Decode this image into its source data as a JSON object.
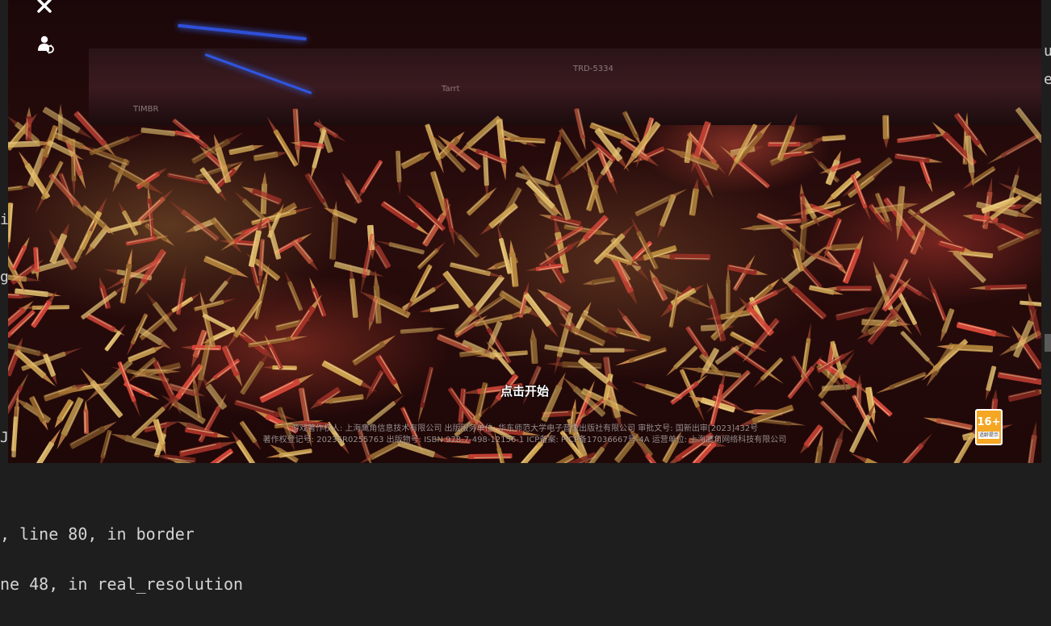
{
  "terminal": {
    "lines": [
      ", line 80, in border",
      "ne 48, in real_resolution"
    ],
    "side_chars": [
      "u",
      "e",
      "i",
      "g",
      "J"
    ]
  },
  "game": {
    "start_label": "点击开始",
    "info_lines": [
      "游戏著作权人: 上海鹰角信息技术有限公司 出版服务单位: 华东师范大学电子音像出版社有限公司 审批文号: 国新出审[2023]432号",
      "著作权登记号: 2023SR0255763 出版物号: ISBN 978-7-498-12156-1 ICP备案: PICP备17036667号-4A 运营单位: 上海鹰角网络科技有限公司"
    ],
    "age_rating": {
      "number": "16+",
      "label": "适龄提示"
    },
    "rifle_markings": [
      "TRD-5334",
      "Tarrt",
      "TIMBR"
    ],
    "colors": {
      "accent_blue": "#2f4fd8",
      "badge": "#f5a623",
      "brass": "#c9a34a",
      "red_cartridge": "#d0453a"
    }
  }
}
